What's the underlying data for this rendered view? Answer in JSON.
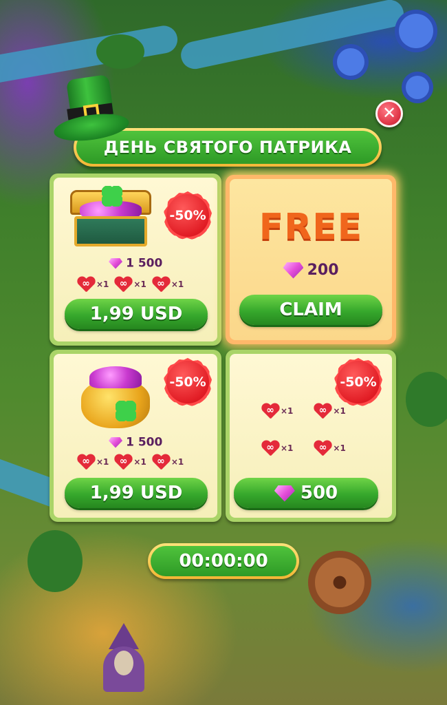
{
  "event_title": "ДЕНЬ СВЯТОГО ПАТРИКА",
  "close_symbol": "✕",
  "offers": [
    {
      "type": "chest",
      "discount": "-50%",
      "gems": "1 500",
      "boosts": [
        {
          "symbol": "∞",
          "mult": "×1"
        },
        {
          "symbol": "∞",
          "mult": "×1"
        },
        {
          "symbol": "∞",
          "mult": "×1"
        }
      ],
      "price": "1,99 USD"
    },
    {
      "type": "free",
      "label": "FREE",
      "gems": "200",
      "button": "CLAIM"
    },
    {
      "type": "pot",
      "discount": "-50%",
      "gems": "1 500",
      "boosts": [
        {
          "symbol": "∞",
          "mult": "×1"
        },
        {
          "symbol": "∞",
          "mult": "×1"
        },
        {
          "symbol": "∞",
          "mult": "×1"
        }
      ],
      "price": "1,99 USD"
    },
    {
      "type": "hearts",
      "discount": "-50%",
      "boosts": [
        {
          "symbol": "∞",
          "mult": "×1"
        },
        {
          "symbol": "∞",
          "mult": "×1"
        },
        {
          "symbol": "∞",
          "mult": "×1"
        },
        {
          "symbol": "∞",
          "mult": "×1"
        }
      ],
      "price_gems": "500"
    }
  ],
  "timer": "00:00:00",
  "colors": {
    "button_green": "#36a82c",
    "badge_red": "#e11c24",
    "free_orange": "#f0661c",
    "card_border": "#aad468",
    "banner_gold": "#f2b634"
  },
  "icons": [
    "close-icon",
    "leprechaun-hat-icon",
    "treasure-chest-icon",
    "gold-pot-icon",
    "gem-icon",
    "infinite-heart-icon",
    "clover-icon"
  ]
}
